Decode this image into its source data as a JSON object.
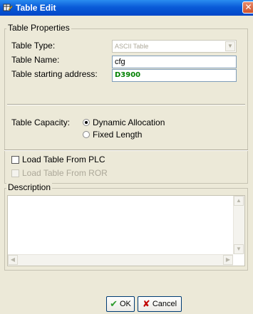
{
  "window": {
    "title": "Table Edit",
    "close_symbol": "✕"
  },
  "properties": {
    "legend": "Table Properties",
    "type_label": "Table Type:",
    "type_value": "ASCII Table",
    "name_label": "Table Name:",
    "name_value": "cfg",
    "address_label": "Table starting address:",
    "address_value": "D3900",
    "capacity_label": "Table Capacity:",
    "capacity_options": [
      {
        "label": "Dynamic Allocation",
        "checked": true
      },
      {
        "label": "Fixed Length",
        "checked": false
      }
    ]
  },
  "load": {
    "from_plc_label": "Load Table From PLC",
    "from_ror_label": "Load Table From ROR"
  },
  "description": {
    "legend": "Description",
    "text": ""
  },
  "buttons": {
    "ok": "OK",
    "cancel": "Cancel"
  },
  "icons": {
    "title_icon": "table-edit-icon",
    "close": "close-icon",
    "ok": "checkmark-icon",
    "cancel": "x-icon",
    "scroll_up": "scroll-up-icon",
    "scroll_down": "scroll-down-icon",
    "scroll_left": "scroll-left-icon",
    "scroll_right": "scroll-right-icon"
  },
  "colors": {
    "title_bar": "#0a5bd8",
    "address_text": "#008000",
    "ok_icon": "#2e9c2e",
    "cancel_icon": "#c00000"
  }
}
